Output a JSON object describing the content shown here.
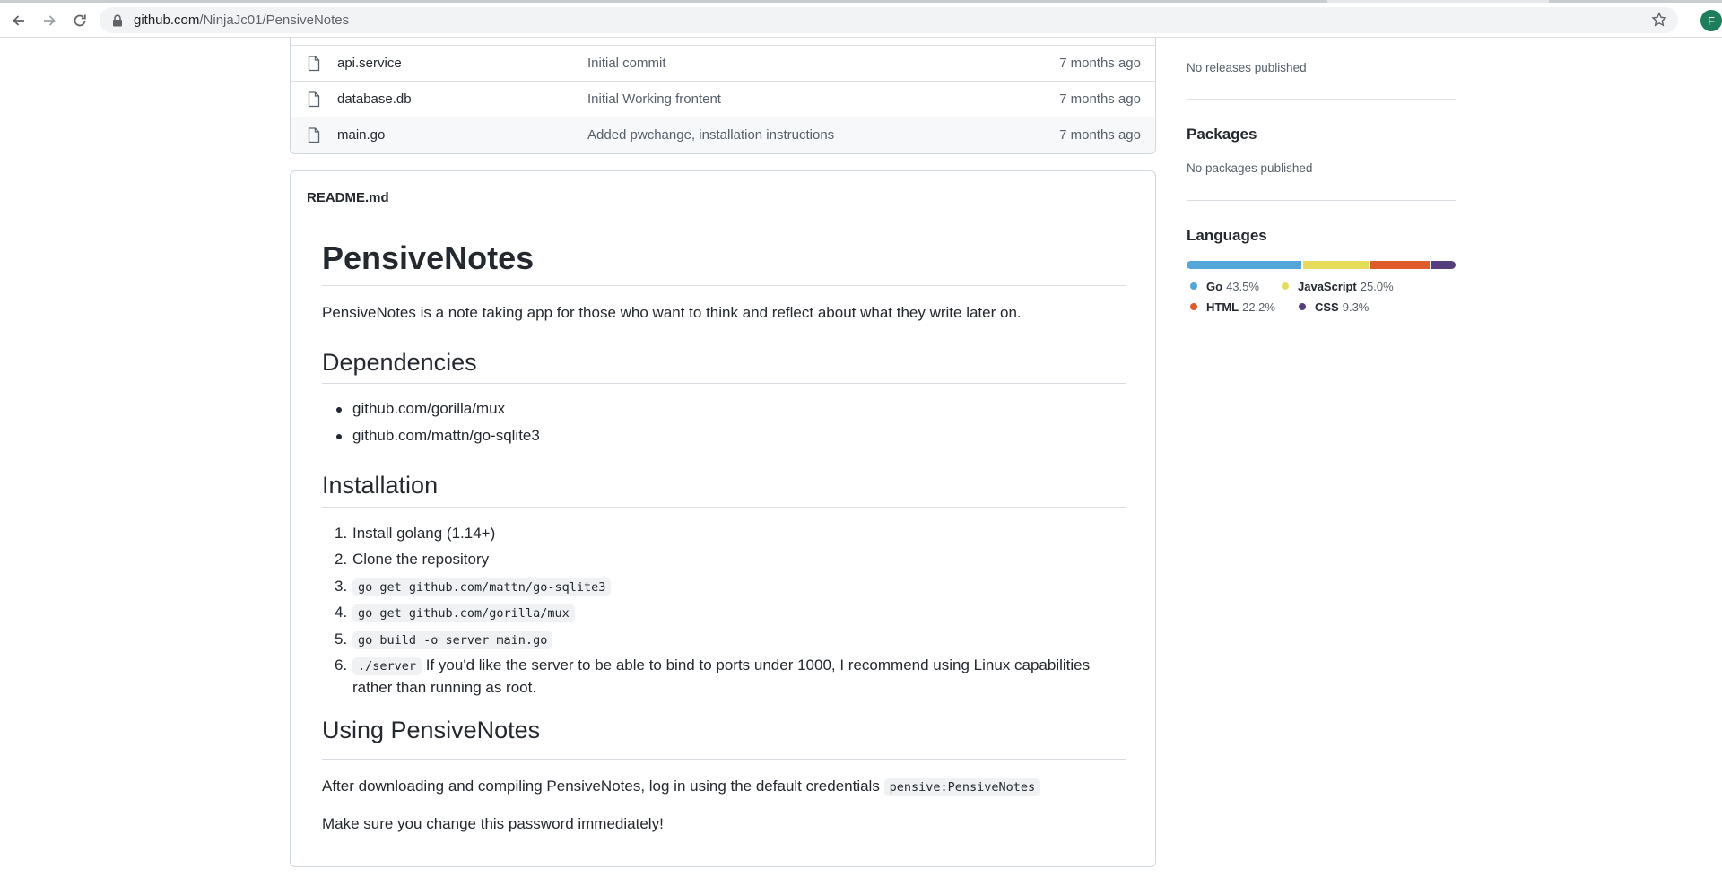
{
  "browser": {
    "url_host": "github.com",
    "url_path": "/NinjaJc01/PensiveNotes",
    "profile_initial": "F"
  },
  "files": [
    {
      "name": "api.service",
      "message": "Initial commit",
      "age": "7 months ago"
    },
    {
      "name": "database.db",
      "message": "Initial Working frontent",
      "age": "7 months ago"
    },
    {
      "name": "main.go",
      "message": "Added pwchange, installation instructions",
      "age": "7 months ago"
    }
  ],
  "readme": {
    "filename": "README.md",
    "title": "PensiveNotes",
    "intro": "PensiveNotes is a note taking app for those who want to think and reflect about what they write later on.",
    "dependencies_heading": "Dependencies",
    "dependencies": [
      "github.com/gorilla/mux",
      "github.com/mattn/go-sqlite3"
    ],
    "installation_heading": "Installation",
    "steps": [
      {
        "num": "1.",
        "text": "Install golang (1.14+)"
      },
      {
        "num": "2.",
        "text": "Clone the repository"
      },
      {
        "num": "3.",
        "code": "go get github.com/mattn/go-sqlite3"
      },
      {
        "num": "4.",
        "code": "go get github.com/gorilla/mux"
      },
      {
        "num": "5.",
        "code": "go build -o server main.go"
      },
      {
        "num": "6.",
        "code": "./server",
        "text": "If you'd like the server to be able to bind to ports under 1000, I recommend using Linux capabilities",
        "text2": "rather than running as root."
      }
    ],
    "using_heading": "Using PensiveNotes",
    "using_text": "After downloading and compiling PensiveNotes, log in using the default credentials",
    "using_code": "pensive:PensiveNotes",
    "warning": "Make sure you change this password immediately!"
  },
  "sidebar": {
    "releases_text": "No releases published",
    "packages_heading": "Packages",
    "packages_text": "No packages published",
    "languages_heading": "Languages",
    "languages": [
      {
        "name": "Go",
        "percent": "43.5%",
        "value": 43.5,
        "color": "#54a5d8"
      },
      {
        "name": "JavaScript",
        "percent": "25.0%",
        "value": 25.0,
        "color": "#e6dc5c"
      },
      {
        "name": "HTML",
        "percent": "22.2%",
        "value": 22.2,
        "color": "#de5c2c"
      },
      {
        "name": "CSS",
        "percent": "9.3%",
        "value": 9.3,
        "color": "#563d7c"
      }
    ]
  }
}
